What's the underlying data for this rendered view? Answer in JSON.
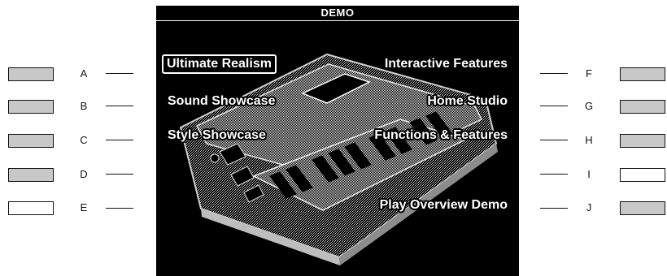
{
  "screen": {
    "title": "DEMO"
  },
  "menu": {
    "left": [
      {
        "letter": "A",
        "label": "Ultimate Realism",
        "selected": true
      },
      {
        "letter": "B",
        "label": "Sound Showcase"
      },
      {
        "letter": "C",
        "label": "Style Showcase"
      },
      {
        "letter": "D",
        "label": ""
      },
      {
        "letter": "E",
        "label": ""
      }
    ],
    "right": [
      {
        "letter": "F",
        "label": "Interactive Features"
      },
      {
        "letter": "G",
        "label": "Home Studio"
      },
      {
        "letter": "H",
        "label": "Functions & Features"
      },
      {
        "letter": "I",
        "label": ""
      },
      {
        "letter": "J",
        "label": "Play Overview Demo"
      }
    ]
  },
  "colors": {
    "lcd_background": "#000000",
    "lcd_text": "#ffffff",
    "button_active": "#c8c8c8",
    "button_unassigned": "#ffffff"
  },
  "icons": {
    "keyboard_art": "keyboard-illustration-icon"
  }
}
